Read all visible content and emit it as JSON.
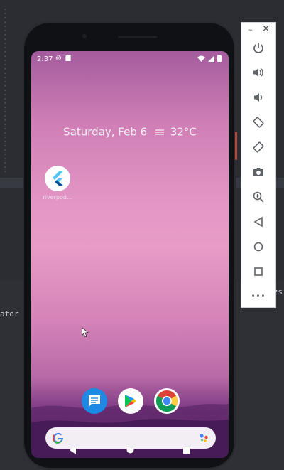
{
  "ide": {
    "left_fragment": "ator",
    "right_fragment": "zs"
  },
  "phone": {
    "status": {
      "time": "2:37",
      "left_icons": [
        "settings-gear-icon",
        "sd-card-icon"
      ],
      "right_icons": [
        "wifi-icon",
        "signal-icon",
        "battery-icon"
      ]
    },
    "glance": {
      "date": "Saturday, Feb 6",
      "weather_icon": "weather-icon",
      "temperature": "32°C"
    },
    "home_apps": [
      {
        "name": "flutter-app",
        "label": "riverpod..."
      }
    ],
    "dock": [
      {
        "name": "messages-app-icon"
      },
      {
        "name": "play-store-icon"
      },
      {
        "name": "chrome-icon"
      }
    ],
    "search": {
      "logo": "google-g-icon",
      "assistant": "assistant-mic-icon"
    },
    "nav": [
      "back-button",
      "home-button",
      "overview-button"
    ]
  },
  "emulator_toolbar": {
    "window_buttons": {
      "close": "×",
      "minimize": "–"
    },
    "items": [
      "power-button",
      "volume-up-button",
      "volume-down-button",
      "rotate-left-button",
      "rotate-right-button",
      "screenshot-button",
      "zoom-button",
      "back-button",
      "home-button",
      "overview-button",
      "more-button"
    ],
    "more_label": "•••"
  },
  "colors": {
    "wallpaper_top": "#a45c9e",
    "wallpaper_mid": "#e497c6",
    "wallpaper_bottom": "#4b1e5b",
    "ide_bg": "#2b2d33",
    "toolbar_icon": "#5f6368"
  }
}
